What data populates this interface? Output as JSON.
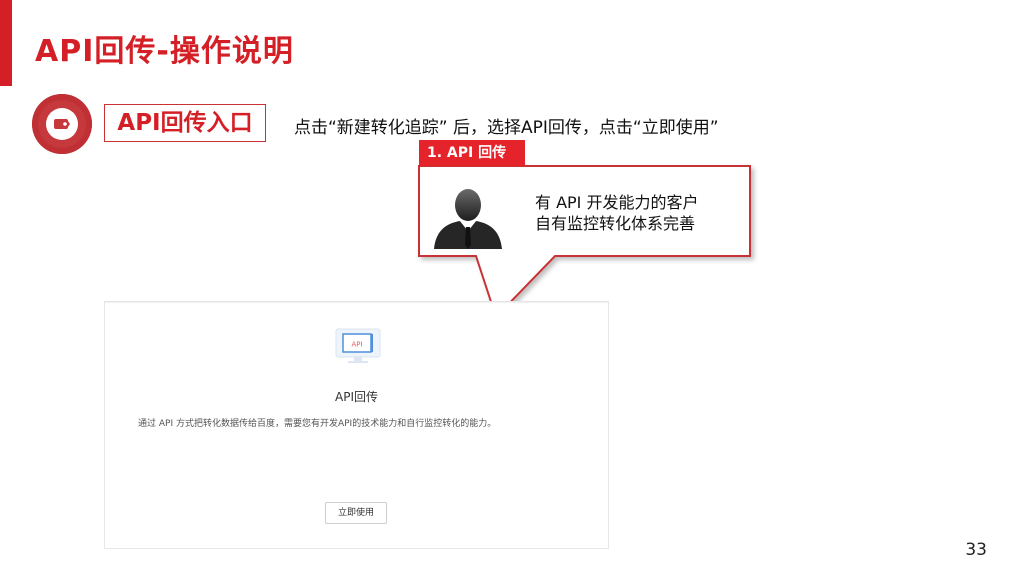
{
  "slide": {
    "title": "API回传-操作说明",
    "entry_label": "API回传入口",
    "instruction": "点击“新建转化追踪” 后，选择API回传，点击“立即使用”",
    "step_tag": "1. API 回传",
    "callout": {
      "line1": "有 API 开发能力的客户",
      "line2": "自有监控转化体系完善"
    },
    "page_number": "33"
  },
  "screen": {
    "icon_label": "API",
    "title": "API回传",
    "description": "通过 API 方式把转化数据传给百度，需要您有开发API的技术能力和自行监控转化的能力。",
    "button_label": "立即使用"
  },
  "colors": {
    "brand_red": "#d41f26",
    "tag_red": "#e4232b",
    "icon_circle": "#c5383c"
  },
  "icons": {
    "section_icon": "tag-icon",
    "person_icon": "businessman-avatar-icon",
    "api_icon": "api-monitor-icon"
  }
}
